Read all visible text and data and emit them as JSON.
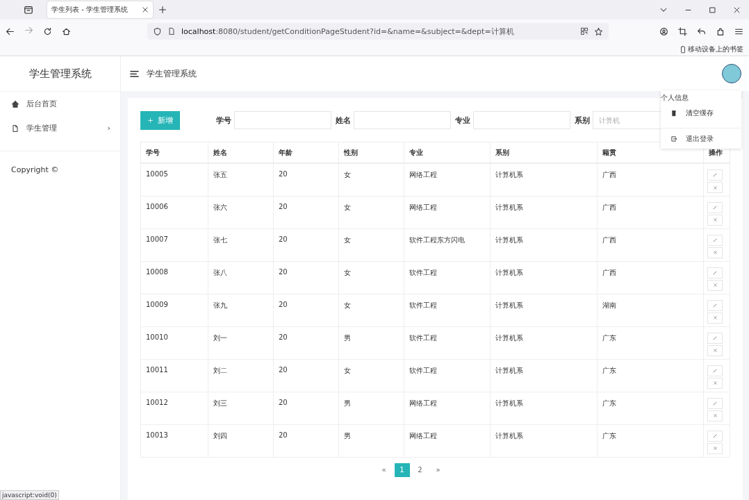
{
  "browser": {
    "tab_title": "学生列表 - 学生管理系统",
    "url_host": "localhost",
    "url_rest": ":8080/student/getConditionPageStudent?id=&name=&subject=&dept=计算机",
    "bookmarks_label": "移动设备上的书签",
    "status_text": "javascript:void(0)"
  },
  "sidebar": {
    "brand": "学生管理系统",
    "items": [
      {
        "kind": "home",
        "label": "后台首页"
      },
      {
        "kind": "file",
        "label": "学生管理",
        "arrow": "›"
      }
    ],
    "copyright": "Copyright ©"
  },
  "header": {
    "title": "学生管理系统"
  },
  "user_menu": {
    "heading": "个人信息",
    "items": [
      {
        "kind": "trash",
        "label": "清空缓存"
      },
      {
        "kind": "logout",
        "label": "退出登录"
      }
    ]
  },
  "toolbar": {
    "add_button": "新增",
    "filters": [
      {
        "label": "学号"
      },
      {
        "label": "姓名"
      },
      {
        "label": "专业"
      },
      {
        "label": "系别",
        "placeholder": "计算机"
      }
    ]
  },
  "table": {
    "columns": [
      "学号",
      "姓名",
      "年龄",
      "性别",
      "专业",
      "系别",
      "籍贯",
      "操作"
    ],
    "rows": [
      [
        "10005",
        "张五",
        "20",
        "女",
        "网络工程",
        "计算机系",
        "广西"
      ],
      [
        "10006",
        "张六",
        "20",
        "女",
        "网络工程",
        "计算机系",
        "广西"
      ],
      [
        "10007",
        "张七",
        "20",
        "女",
        "软件工程东方闪电",
        "计算机系",
        "广西"
      ],
      [
        "10008",
        "张八",
        "20",
        "女",
        "软件工程",
        "计算机系",
        "广西"
      ],
      [
        "10009",
        "张九",
        "20",
        "女",
        "软件工程",
        "计算机系",
        "湖南"
      ],
      [
        "10010",
        "刘一",
        "20",
        "男",
        "软件工程",
        "计算机系",
        "广东"
      ],
      [
        "10011",
        "刘二",
        "20",
        "女",
        "软件工程",
        "计算机系",
        "广东"
      ],
      [
        "10012",
        "刘三",
        "20",
        "男",
        "网络工程",
        "计算机系",
        "广东"
      ],
      [
        "10013",
        "刘四",
        "20",
        "男",
        "网络工程",
        "计算机系",
        "广东"
      ]
    ]
  },
  "pagination": [
    {
      "label": "«",
      "selected": false
    },
    {
      "label": "1",
      "selected": true
    },
    {
      "label": "2",
      "selected": false
    },
    {
      "label": "»",
      "selected": false
    }
  ]
}
